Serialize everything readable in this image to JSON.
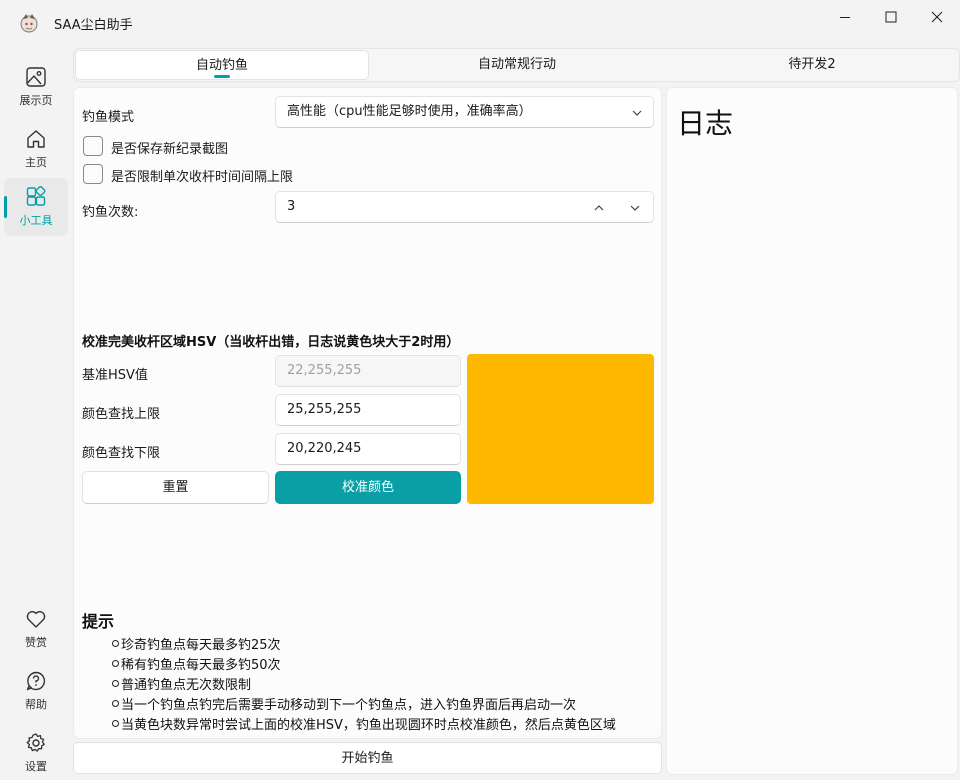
{
  "window": {
    "title": "SAA尘白助手"
  },
  "sidebar": {
    "top_items": [
      {
        "label": "展示页",
        "icon": "image-icon"
      },
      {
        "label": "主页",
        "icon": "home-icon"
      },
      {
        "label": "小工具",
        "icon": "apps-icon",
        "active": true
      }
    ],
    "bottom_items": [
      {
        "label": "赞赏",
        "icon": "heart-icon"
      },
      {
        "label": "帮助",
        "icon": "help-icon"
      },
      {
        "label": "设置",
        "icon": "gear-icon"
      }
    ]
  },
  "tabs": [
    {
      "label": "自动钓鱼",
      "active": true
    },
    {
      "label": "自动常规行动"
    },
    {
      "label": "待开发2"
    }
  ],
  "fishing": {
    "mode_label": "钓鱼模式",
    "mode_value": "高性能（cpu性能足够时使用，准确率高）",
    "save_screenshot_label": "是否保存新纪录截图",
    "limit_interval_label": "是否限制单次收杆时间间隔上限",
    "count_label": "钓鱼次数:",
    "count_value": "3"
  },
  "calibration": {
    "title": "校准完美收杆区域HSV（当收杆出错，日志说黄色块大于2时用）",
    "base_label": "基准HSV值",
    "base_value": "22,255,255",
    "upper_label": "颜色查找上限",
    "upper_value": "25,255,255",
    "lower_label": "颜色查找下限",
    "lower_value": "20,220,245",
    "reset_label": "重置",
    "calibrate_label": "校准颜色",
    "swatch_color": "#FFB800"
  },
  "tips": {
    "title": "提示",
    "items": [
      "珍奇钓鱼点每天最多钓25次",
      "稀有钓鱼点每天最多钓50次",
      "普通钓鱼点无次数限制",
      "当一个钓鱼点钓完后需要手动移动到下一个钓鱼点，进入钓鱼界面后再启动一次",
      "当黄色块数异常时尝试上面的校准HSV，钓鱼出现圆环时点校准颜色，然后点黄色区域"
    ]
  },
  "start_label": "开始钓鱼",
  "log": {
    "title": "日志"
  },
  "colors": {
    "accent": "#009FAA",
    "primary_button": "#0A9EA5",
    "background": "#F3F3F3"
  }
}
